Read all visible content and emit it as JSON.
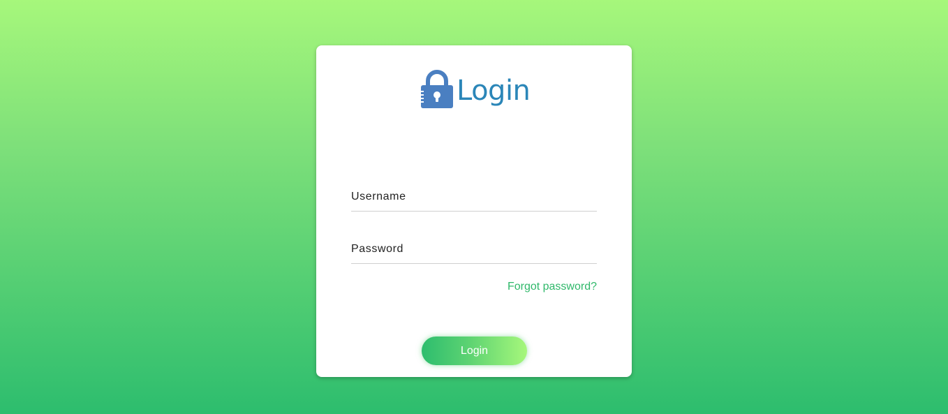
{
  "login_card": {
    "title": "Login",
    "logo_icon": "padlock-icon",
    "username": {
      "placeholder": "Username",
      "value": ""
    },
    "password": {
      "placeholder": "Password",
      "value": ""
    },
    "forgot_password_label": "Forgot password?",
    "submit_label": "Login"
  },
  "colors": {
    "background_top": "#a6f77b",
    "background_bottom": "#2dbd6e",
    "title": "#2b86b8",
    "lock_icon": "#4a7fc1",
    "link": "#2fb86a"
  }
}
